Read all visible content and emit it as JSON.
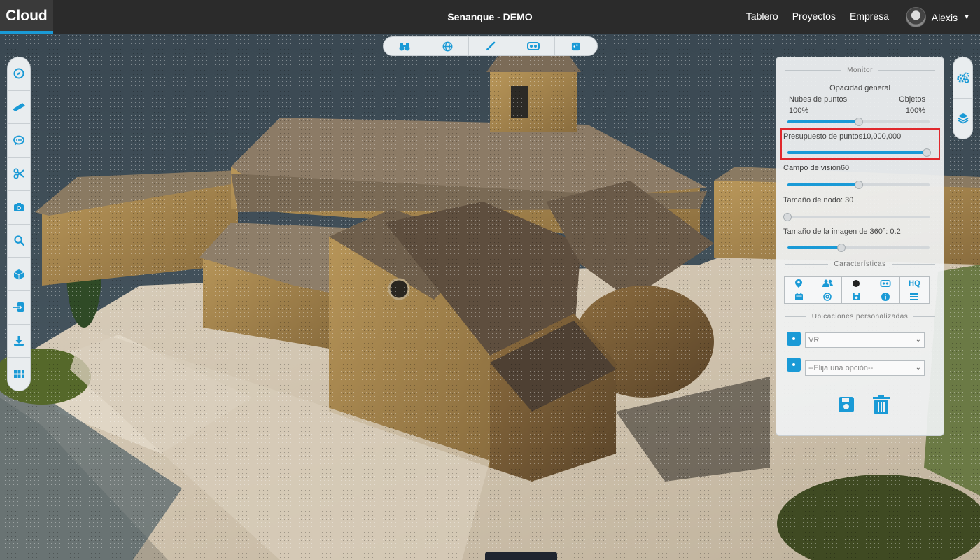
{
  "header": {
    "brand": "Cloud",
    "project_title": "Senanque - DEMO",
    "nav": [
      "Tablero",
      "Proyectos",
      "Empresa"
    ],
    "user_name": "Alexis"
  },
  "top_toolbar": [
    "binoculars-icon",
    "globe-icon",
    "brush-icon",
    "vr-icon",
    "cube-icon"
  ],
  "left_toolbar": [
    "compass-icon",
    "ruler-icon",
    "comment-icon",
    "scissors-icon",
    "camera-icon",
    "search-icon",
    "box-icon",
    "import-icon",
    "download-icon",
    "grid-icon"
  ],
  "right_toolbar": [
    "settings-icon",
    "layers-icon"
  ],
  "panel": {
    "monitor_title": "Monitor",
    "opacity_title": "Opacidad general",
    "opacity_left_label": "Nubes de puntos",
    "opacity_right_label": "Objetos",
    "opacity_left_value": "100%",
    "opacity_right_value": "100%",
    "opacity_slider": 0.5,
    "point_budget_label": "Presupuesto de puntos",
    "point_budget_value": "10,000,000",
    "point_budget_slider": 0.98,
    "fov_label": "Campo de visión",
    "fov_value": "60",
    "fov_slider": 0.5,
    "node_size_label": "Tamaño de nodo: 30",
    "node_size_slider": 0.0,
    "image360_label": "Tamaño de la imagen de 360°: 0.2",
    "image360_slider": 0.38,
    "features_title": "Características",
    "features_row1": [
      "pin-icon",
      "users-icon",
      "dot-icon",
      "vr-icon",
      "HQ"
    ],
    "features_row2": [
      "calendar-icon",
      "circle-icon",
      "save-icon",
      "info-icon",
      "list-icon"
    ],
    "locations_title": "Ubicaciones personalizadas",
    "location_select_1": "VR",
    "location_select_2": "--Elija una opción--",
    "save_action": "save-icon",
    "delete_action": "trash-icon"
  },
  "colors": {
    "accent": "#1a9ad6",
    "topbar": "#2b2b2b",
    "highlight": "#e0282d"
  }
}
